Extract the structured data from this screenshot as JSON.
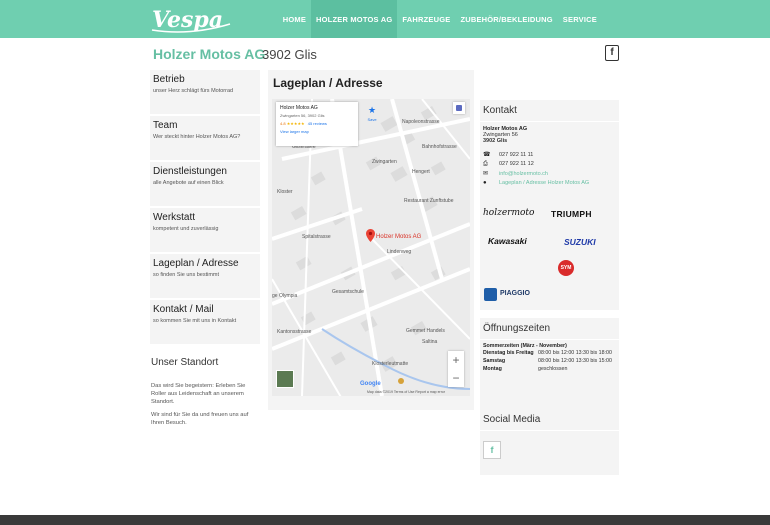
{
  "header": {
    "logo_text": "Vespa",
    "nav": [
      {
        "label": "HOME",
        "active": false
      },
      {
        "label": "HOLZER MOTOS AG",
        "active": true
      },
      {
        "label": "FAHRZEUGE",
        "active": false
      },
      {
        "label": "ZUBEHÖR/BEKLEIDUNG",
        "active": false
      },
      {
        "label": "SERVICE",
        "active": false
      }
    ]
  },
  "brand": {
    "name": "Holzer Motos AG",
    "city": "3902 Glis"
  },
  "sidebar": {
    "items": [
      {
        "title": "Betrieb",
        "subtitle": "unser Herz schlägt fürs Motorrad"
      },
      {
        "title": "Team",
        "subtitle": "Wer steckt hinter Holzer Motos AG?"
      },
      {
        "title": "Dienstleistungen",
        "subtitle": "alle Angebote auf einen Blick"
      },
      {
        "title": "Werkstatt",
        "subtitle": "kompetent und zuverlässig"
      },
      {
        "title": "Lageplan / Adresse",
        "subtitle": "so finden Sie uns bestimmt"
      },
      {
        "title": "Kontakt / Mail",
        "subtitle": "so kommen Sie mit uns in Kontakt"
      }
    ],
    "standort": {
      "title": "Unser Standort",
      "p1": "Das wird Sie begeistern: Erleben Sie Roller aus Leidenschaft an unserem Standort.",
      "p2": "Wir sind für Sie da und freuen uns auf Ihren Besuch."
    }
  },
  "main": {
    "title": "Lageplan / Adresse"
  },
  "map": {
    "card_name": "Holzer Motos AG",
    "card_address": "Zwingarten 56, 3902 Glis",
    "rating": "4.8",
    "stars": "★★★★★",
    "reviews": "45 reviews",
    "larger_map": "View larger map",
    "save_label": "Save",
    "pin_label": "Holzer Motos AG",
    "restaurant_label": "Restaurant Zunftstube",
    "olympia_label": "ge Olympia",
    "handels_label": "Gemmet Handels",
    "google_label": "Google",
    "footer": "Map data ©2019   Terms of Use   Report a map error",
    "streets": [
      {
        "text": "Zwingarten"
      },
      {
        "text": "Napoleonstrasse"
      },
      {
        "text": "Gliserallee"
      },
      {
        "text": "Bahnhofstrasse"
      },
      {
        "text": "Kloster"
      },
      {
        "text": "Hengert"
      },
      {
        "text": "Spitalstrasse"
      },
      {
        "text": "Gesamtschule"
      },
      {
        "text": "Klosterleutmatte"
      },
      {
        "text": "Kantonsstrasse"
      },
      {
        "text": "Lindenweg"
      },
      {
        "text": "Saltina"
      }
    ],
    "zoom_in": "+",
    "zoom_out": "−"
  },
  "kontakt": {
    "title": "Kontakt",
    "name": "Holzer Motos AG",
    "street": "Zwingarten 56",
    "zip": "3902",
    "city": "Glis",
    "phone": "027 922 11 11",
    "fax": "027 922 11 12",
    "email": "info@holzermoto.ch",
    "map_link": "Lageplan / Adresse Holzer Motos AG",
    "brands": [
      "holzermoto",
      "TRIUMPH",
      "Kawasaki",
      "SUZUKI",
      "SYM",
      "PIAGGIO"
    ]
  },
  "hours": {
    "title": "Öffnungszeiten",
    "season": "Sommerzeiten  (März - November)",
    "rows": [
      {
        "day": "Dienstag bis Freitag",
        "time": "08:00 bis 12:00 13:30 bis 18:00"
      },
      {
        "day": "Samstag",
        "time": "08:00 bis 12:00 13:30 bis 15:00"
      },
      {
        "day": "Montag",
        "time": "geschlossen"
      }
    ]
  },
  "social": {
    "title": "Social Media",
    "fb": "f"
  },
  "colors": {
    "teal": "#6fcfb0",
    "teal_dark": "#5cbfa0",
    "brand": "#66bfa3",
    "footer": "#3a3a3a"
  }
}
